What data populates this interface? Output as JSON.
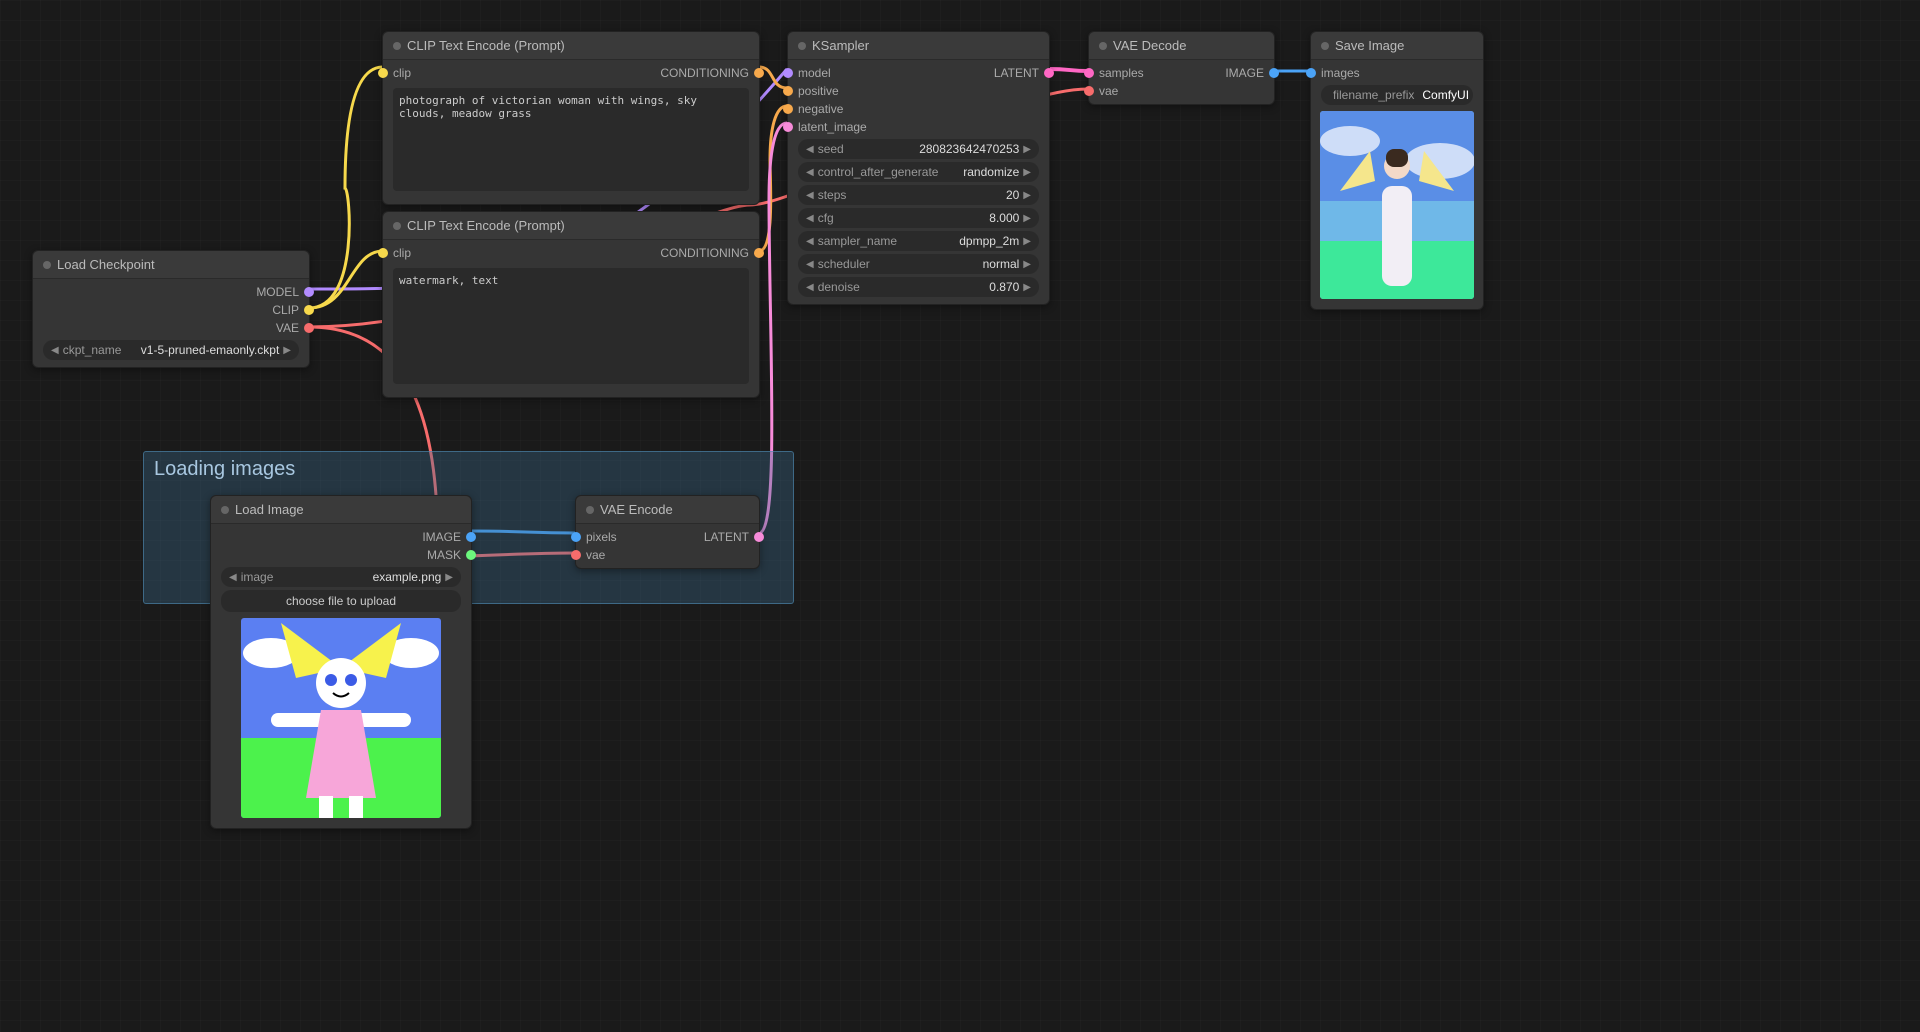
{
  "nodes": {
    "load_checkpoint": {
      "title": "Load Checkpoint",
      "outputs": [
        "MODEL",
        "CLIP",
        "VAE"
      ],
      "ckpt_label": "ckpt_name",
      "ckpt_value": "v1-5-pruned-emaonly.ckpt"
    },
    "clip_pos": {
      "title": "CLIP Text Encode (Prompt)",
      "input": "clip",
      "output": "CONDITIONING",
      "text": "photograph of victorian woman with wings, sky clouds, meadow grass"
    },
    "clip_neg": {
      "title": "CLIP Text Encode (Prompt)",
      "input": "clip",
      "output": "CONDITIONING",
      "text": "watermark, text"
    },
    "ksampler": {
      "title": "KSampler",
      "inputs": [
        "model",
        "positive",
        "negative",
        "latent_image"
      ],
      "output": "LATENT",
      "widgets": [
        {
          "name": "seed",
          "value": "280823642470253"
        },
        {
          "name": "control_after_generate",
          "value": "randomize"
        },
        {
          "name": "steps",
          "value": "20"
        },
        {
          "name": "cfg",
          "value": "8.000"
        },
        {
          "name": "sampler_name",
          "value": "dpmpp_2m"
        },
        {
          "name": "scheduler",
          "value": "normal"
        },
        {
          "name": "denoise",
          "value": "0.870"
        }
      ]
    },
    "vae_decode": {
      "title": "VAE Decode",
      "inputs": [
        "samples",
        "vae"
      ],
      "output": "IMAGE"
    },
    "save_image": {
      "title": "Save Image",
      "input": "images",
      "prefix_label": "filename_prefix",
      "prefix_value": "ComfyUI"
    },
    "load_image": {
      "title": "Load Image",
      "outputs": [
        "IMAGE",
        "MASK"
      ],
      "image_label": "image",
      "image_value": "example.png",
      "upload_label": "choose file to upload"
    },
    "vae_encode": {
      "title": "VAE Encode",
      "inputs": [
        "pixels",
        "vae"
      ],
      "output": "LATENT"
    }
  },
  "group": {
    "title": "Loading images"
  }
}
